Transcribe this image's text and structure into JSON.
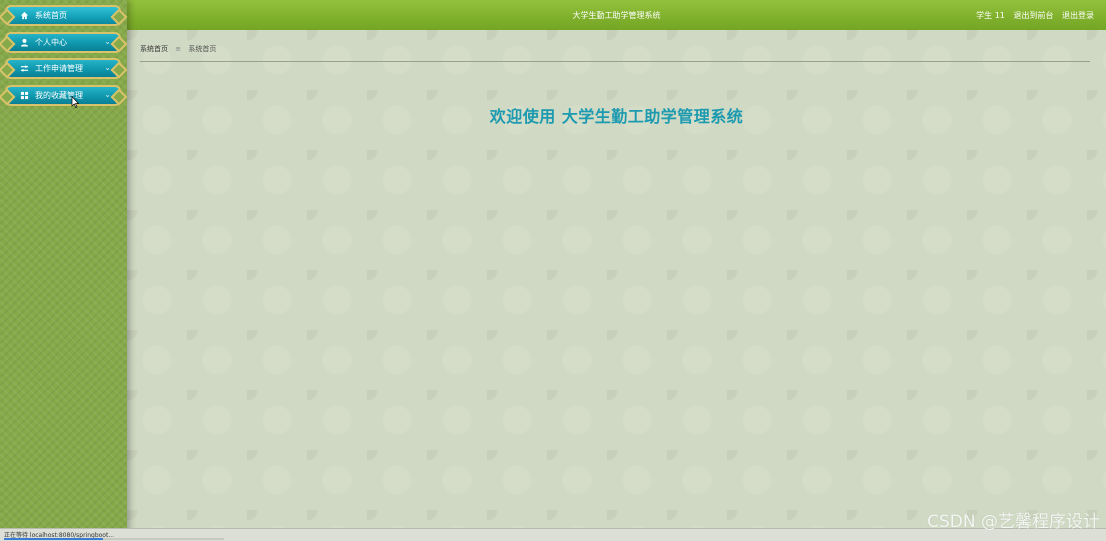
{
  "header": {
    "title": "大学生勤工助学管理系统",
    "user_label": "学生 11",
    "back_label": "退出到前台",
    "logout_label": "退出登录"
  },
  "sidebar": {
    "items": [
      {
        "label": "系统首页",
        "icon": "home-icon"
      },
      {
        "label": "个人中心",
        "icon": "user-icon"
      },
      {
        "label": "工作申请管理",
        "icon": "sliders-icon"
      },
      {
        "label": "我的收藏管理",
        "icon": "grid-icon"
      }
    ]
  },
  "breadcrumb": {
    "items": [
      "系统首页",
      "系统首页"
    ],
    "separator": "≡"
  },
  "welcome": {
    "prefix": "欢迎使用",
    "system_name": "大学生勤工助学管理系统"
  },
  "status_bar": {
    "text": "正在等待 localhost:8080/springboot...",
    "progress": 0.45
  },
  "watermark": "CSDN @艺馨程序设计",
  "colors": {
    "accent": "#1b9ab0",
    "header_green": "#7fb02c",
    "sidebar_green": "#86a94a",
    "menu_teal": "#0f97ad",
    "menu_border": "#d9c36a"
  }
}
